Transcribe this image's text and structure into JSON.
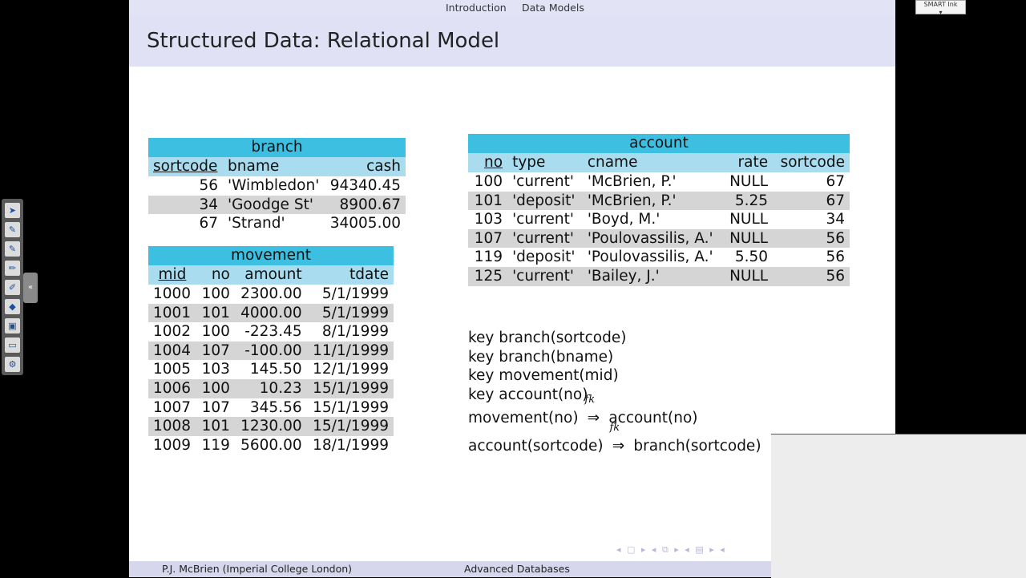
{
  "nav": {
    "items": [
      "Introduction",
      "Data Models"
    ]
  },
  "title": "Structured Data: Relational Model",
  "branch": {
    "name": "branch",
    "headers": [
      "sortcode",
      "bname",
      "cash"
    ],
    "rows": [
      [
        "56",
        "'Wimbledon'",
        "94340.45"
      ],
      [
        "34",
        "'Goodge St'",
        "8900.67"
      ],
      [
        "67",
        "'Strand'",
        "34005.00"
      ]
    ]
  },
  "movement": {
    "name": "movement",
    "headers": [
      "mid",
      "no",
      "amount",
      "tdate"
    ],
    "rows": [
      [
        "1000",
        "100",
        "2300.00",
        "5/1/1999"
      ],
      [
        "1001",
        "101",
        "4000.00",
        "5/1/1999"
      ],
      [
        "1002",
        "100",
        "-223.45",
        "8/1/1999"
      ],
      [
        "1004",
        "107",
        "-100.00",
        "11/1/1999"
      ],
      [
        "1005",
        "103",
        "145.50",
        "12/1/1999"
      ],
      [
        "1006",
        "100",
        "10.23",
        "15/1/1999"
      ],
      [
        "1007",
        "107",
        "345.56",
        "15/1/1999"
      ],
      [
        "1008",
        "101",
        "1230.00",
        "15/1/1999"
      ],
      [
        "1009",
        "119",
        "5600.00",
        "18/1/1999"
      ]
    ]
  },
  "account": {
    "name": "account",
    "headers": [
      "no",
      "type",
      "cname",
      "rate",
      "sortcode"
    ],
    "rows": [
      [
        "100",
        "'current'",
        "'McBrien, P.'",
        "NULL",
        "67"
      ],
      [
        "101",
        "'deposit'",
        "'McBrien, P.'",
        "5.25",
        "67"
      ],
      [
        "103",
        "'current'",
        "'Boyd, M.'",
        "NULL",
        "34"
      ],
      [
        "107",
        "'current'",
        "'Poulovassilis, A.'",
        "NULL",
        "56"
      ],
      [
        "119",
        "'deposit'",
        "'Poulovassilis, A.'",
        "5.50",
        "56"
      ],
      [
        "125",
        "'current'",
        "'Bailey, J.'",
        "NULL",
        "56"
      ]
    ]
  },
  "constraints": {
    "keys": [
      "key branch(sortcode)",
      "key branch(bname)",
      "key movement(mid)",
      "key account(no)"
    ],
    "fks": [
      {
        "from": "movement(no)",
        "label": "fk",
        "to": "account(no)"
      },
      {
        "from": "account(sortcode)",
        "label": "fk",
        "to": "branch(sortcode)"
      }
    ]
  },
  "footer": {
    "author": "P.J. McBrien  (Imperial College London)",
    "course": "Advanced Databases"
  },
  "smart_ink": "SMART Ink",
  "toolbar_icons": [
    "pointer-icon",
    "pen-icon",
    "pen-icon",
    "highlighter-icon",
    "pen-icon",
    "eraser-icon",
    "note-icon",
    "keyboard-icon",
    "settings-icon"
  ]
}
